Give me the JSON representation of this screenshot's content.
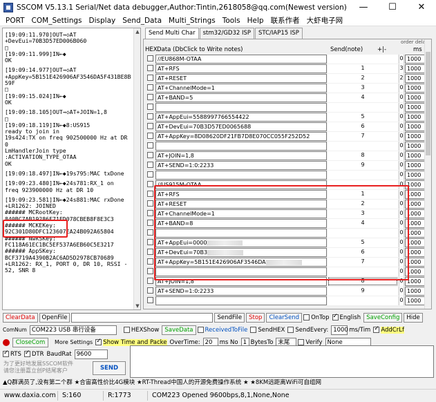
{
  "window": {
    "title": "SSCOM V5.13.1 Serial/Net data debugger,Author:Tintin,2618058@qq.com(Newest version)",
    "minimize": "—",
    "maximize": "☐",
    "close": "✕"
  },
  "menu": [
    "PORT",
    "COM_Settings",
    "Display",
    "Send_Data",
    "Multi_Strings",
    "Tools",
    "Help",
    "联系作者",
    "大虾电子网"
  ],
  "log_lines": [
    "[19:09:11.970]OUT→◇AT",
    "+DevEui=70B3D57ED006B060",
    "□",
    "[19:09:11.999]IN←◆",
    "OK",
    "",
    "[19:09:14.977]OUT→◇AT",
    "+AppKey=5B151E426906AF3546DA5F431BE8B",
    "59F",
    "□",
    "[19:09:15.024]IN←◆",
    "OK",
    "",
    "[19:09:18.105]OUT→◇AT+JOIN=1,8",
    "□",
    "[19:09:18.119]IN←◆8:US915",
    "ready to join in",
    "19s424:TX on freq 902500000 Hz at DR",
    "0",
    "LmHandlerJoin type",
    ":ACTIVATION_TYPE_OTAA",
    "OK",
    "",
    "[19:09:18.497]IN←◆19s795:MAC txDone",
    "",
    "[19:09:23.480]IN←◆24s781:RX_1 on",
    "freq 923900000 Hz at DR 10",
    "",
    "[19:09:23.581]IN←◆24s881:MAC rxDone",
    "+LR1262: JOINED",
    "###### MCRootKey:",
    "840BC7AB19286F71FD078CBEB8F8E3C3",
    "###### MCKEKey:",
    "92C301D80DFC123607EA24B092A65804",
    "###### NwkSKey:",
    "FC118A61EC1BC5EF537A6EB60C5E3217",
    "###### AppSKey:",
    "BCF3719A4390B2AC6AD5D2978CB70689",
    "+LR1262: RX_1, PORT 0, DR 10, RSSI -",
    "52, SNR 8"
  ],
  "tabs": [
    "Send Multi Char",
    "stm32/GD32 ISP",
    "STC/IAP15 ISP"
  ],
  "grid_header": {
    "hex": "HEX",
    "data": "Data (DbClick to Write notes)",
    "send": "Send(note)",
    "order": "+|-",
    "order_label": "order delay",
    "ms": "ms"
  },
  "rows": [
    {
      "data": "//EU868M-OTAA",
      "btn": "",
      "ord": "0",
      "ms": "1000"
    },
    {
      "data": "AT+RFS",
      "btn": "1",
      "ord": "3",
      "ms": "1000"
    },
    {
      "data": "AT+RESET",
      "btn": "2",
      "ord": "2",
      "ms": "1000"
    },
    {
      "data": "AT+ChannelMode=1",
      "btn": "3",
      "ord": "0",
      "ms": "1000"
    },
    {
      "data": "AT+BAND=5",
      "btn": "4",
      "ord": "0",
      "ms": "1000"
    },
    {
      "data": "",
      "btn": "",
      "ord": "0",
      "ms": "1000"
    },
    {
      "data": "AT+AppEui=5588997766554422",
      "btn": "5",
      "ord": "0",
      "ms": "1000"
    },
    {
      "data": "AT+DevEui=70B3D57ED0065688",
      "btn": "6",
      "ord": "0",
      "ms": "1000"
    },
    {
      "data": "AT+AppKey=8D08620DF21FB7D8E070CC055F252D52",
      "btn": "7",
      "ord": "0",
      "ms": "1000"
    },
    {
      "data": "",
      "btn": "",
      "ord": "0",
      "ms": "1000"
    },
    {
      "data": "AT+JOIN=1,8",
      "btn": "8",
      "ord": "0",
      "ms": "1000"
    },
    {
      "data": "AT+SEND=1:0:2233",
      "btn": "9",
      "ord": "0",
      "ms": "1000"
    },
    {
      "data": "",
      "btn": "",
      "ord": "0",
      "ms": "1000"
    },
    {
      "data": "//US915M-OTAA",
      "btn": "",
      "ord": "0",
      "ms": "1000"
    },
    {
      "data": "AT+RFS",
      "btn": "1",
      "ord": "0",
      "ms": "1000"
    },
    {
      "data": "AT+RESET",
      "btn": "2",
      "ord": "0",
      "ms": "1000"
    },
    {
      "data": "AT+ChannelMode=1",
      "btn": "3",
      "ord": "0",
      "ms": "1000"
    },
    {
      "data": "AT+BAND=8",
      "btn": "4",
      "ord": "0",
      "ms": "1000"
    },
    {
      "data": "",
      "btn": "",
      "ord": "0",
      "ms": "1000"
    },
    {
      "data": "AT+AppEui=0000",
      "btn": "5",
      "ord": "0",
      "ms": "1000",
      "blur": true
    },
    {
      "data": "AT+DevEui=70B3",
      "btn": "6",
      "ord": "0",
      "ms": "1000",
      "blur": true
    },
    {
      "data": "AT+AppKey=5B151E426906AF3546DA",
      "btn": "7",
      "ord": "0",
      "ms": "1000",
      "blur": true
    },
    {
      "data": "",
      "btn": "",
      "ord": "0",
      "ms": "1000"
    },
    {
      "data": "AT+JOIN=1,8",
      "btn": "8",
      "ord": "0",
      "ms": "1000"
    },
    {
      "data": "AT+SEND=1:0:2233",
      "btn": "9",
      "ord": "0",
      "ms": "1000"
    },
    {
      "data": "",
      "btn": "",
      "ord": "0",
      "ms": "1000"
    }
  ],
  "bottom": {
    "clear_data": "ClearData",
    "open_file": "OpenFile",
    "send_file": "SendFile",
    "stop": "Stop",
    "clear_send": "ClearSend",
    "on_top": "OnTop",
    "english": "English",
    "save_config": "SaveConfig",
    "hide": "Hide",
    "com_num": "ComNum",
    "com_value": "COM223 USB 串行设备",
    "hex_show": "HEXShow",
    "save_data": "SaveData",
    "received_to_file": "ReceivedToFile",
    "send_hex": "SendHEX",
    "send_every": "SendEvery:",
    "send_every_value": "1000",
    "ms_tim": "ms/Tim",
    "add_crlf": "AddCrLf",
    "close_com": "CloseCom",
    "more_settings": "More Settings",
    "show_time": "Show Time and Packe",
    "overtime": "OverTime:",
    "overtime_value": "20",
    "ms_no": "ms No",
    "no_value": "1",
    "bytes_to": "BytesTo",
    "end_value": "末尾",
    "verify": "Verify",
    "verify_value": "None",
    "rts": "RTS",
    "dtr": "DTR",
    "baudrate": "BaudRat",
    "baud_value": "9600",
    "promo_line1": "为了更好地发展SSCOM软件",
    "promo_line2": "请您注册嘉立创P结尾客户",
    "send": "SEND",
    "ticker": "▲Q群满员了,没有第二个群 ★合宙高性价比4G模块 ★RT-Thread中国人的开源免费操作系统 ★ ★8KM远距离WiFi可自组网"
  },
  "status": {
    "site": "www.daxia.com",
    "s": "S:160",
    "r": "R:1773",
    "port": "COM223 Opened  9600bps,8,1,None,None"
  }
}
